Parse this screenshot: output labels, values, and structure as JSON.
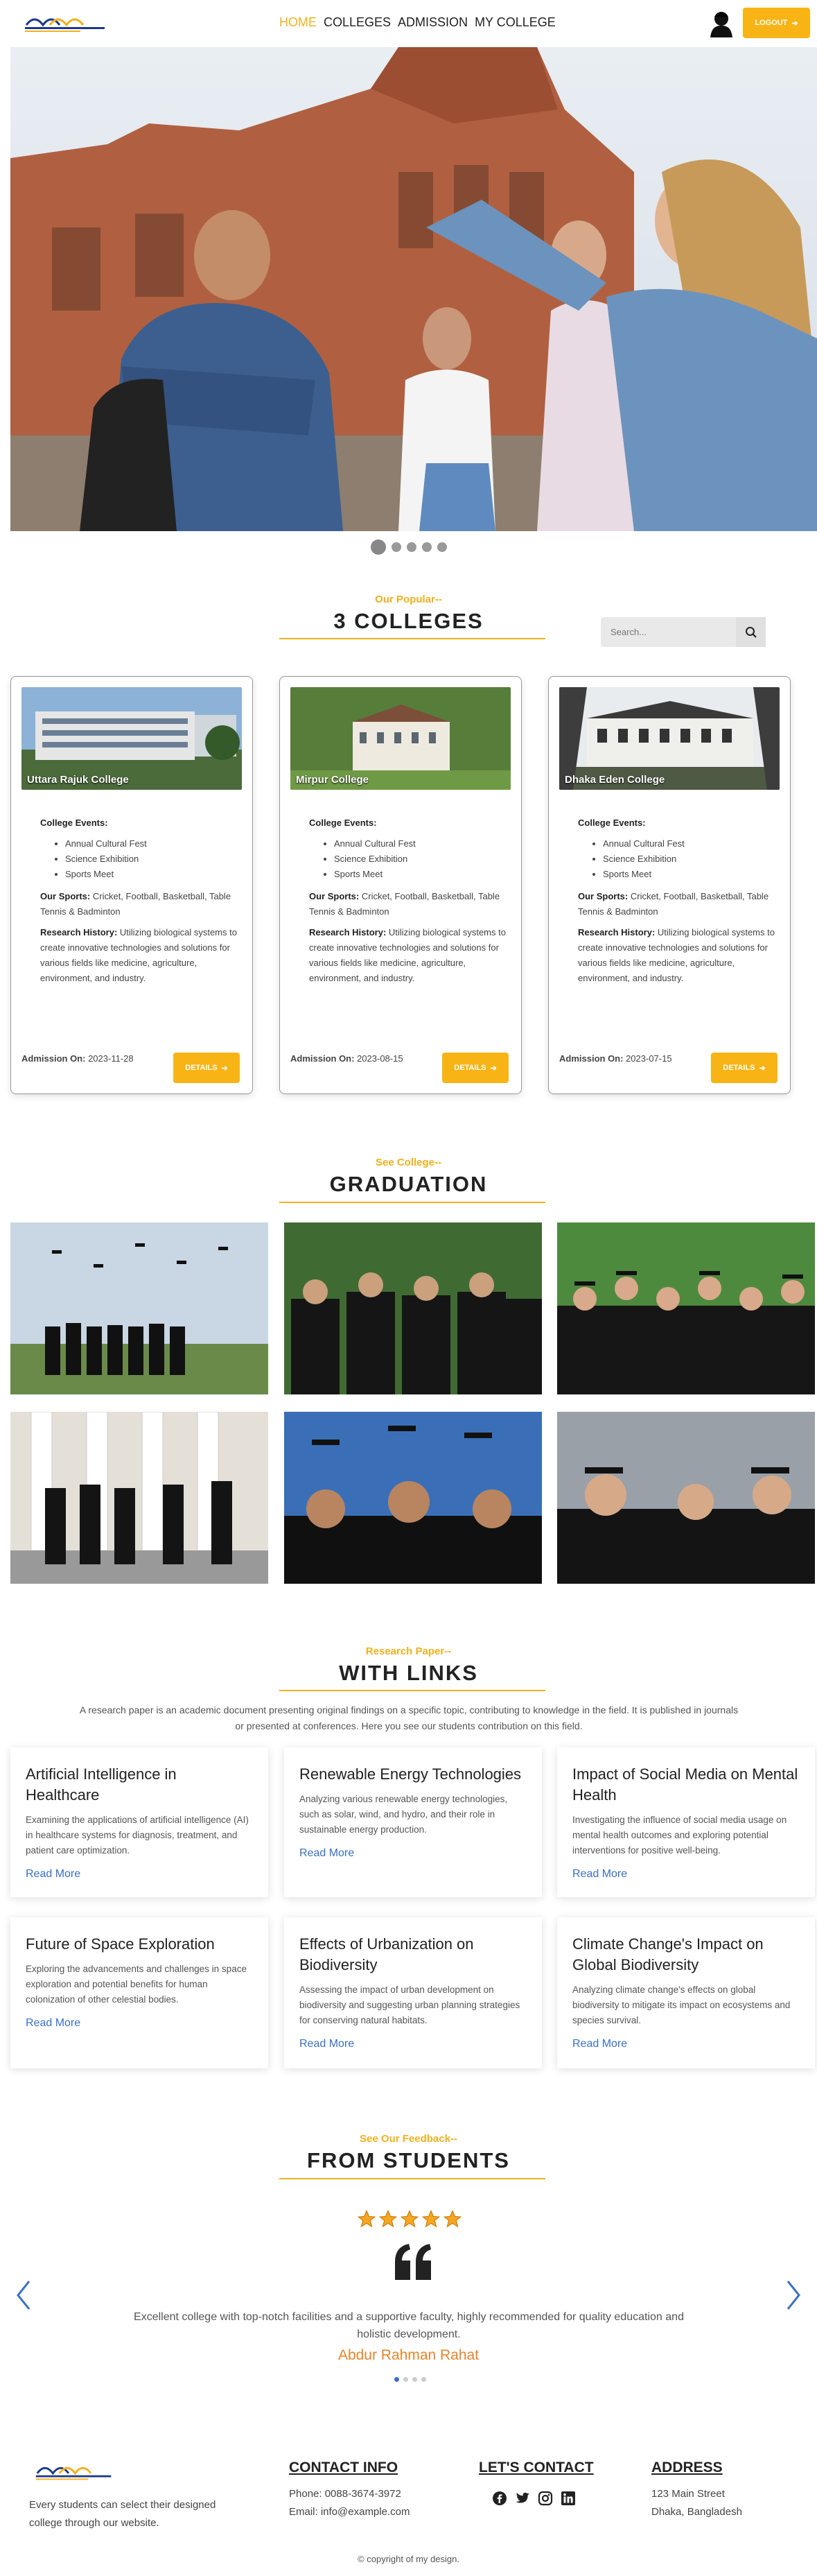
{
  "nav": {
    "links": [
      "HOME",
      "COLLEGES",
      "ADMISSION",
      "MY COLLEGE"
    ],
    "logout_label": "LOGOUT"
  },
  "colleges_section": {
    "subtitle": "Our Popular--",
    "title": "3 COLLEGES",
    "search_placeholder": "Search..."
  },
  "colleges": [
    {
      "name": "Uttara Rajuk College",
      "events_label": "College Events:",
      "events": [
        "Annual Cultural Fest",
        "Science Exhibition",
        "Sports Meet"
      ],
      "sports_label": "Our Sports:",
      "sports": "Cricket, Football, Basketball, Table Tennis & Badminton",
      "research_label": "Research History:",
      "research": "Utilizing biological systems to create innovative technologies and solutions for various fields like medicine, agriculture, environment, and industry.",
      "admission_label": "Admission On:",
      "admission": "2023-11-28",
      "details_label": "DETAILS"
    },
    {
      "name": "Mirpur College",
      "events_label": "College Events:",
      "events": [
        "Annual Cultural Fest",
        "Science Exhibition",
        "Sports Meet"
      ],
      "sports_label": "Our Sports:",
      "sports": "Cricket, Football, Basketball, Table Tennis & Badminton",
      "research_label": "Research History:",
      "research": "Utilizing biological systems to create innovative technologies and solutions for various fields like medicine, agriculture, environment, and industry.",
      "admission_label": "Admission On:",
      "admission": "2023-08-15",
      "details_label": "DETAILS"
    },
    {
      "name": "Dhaka Eden College",
      "events_label": "College Events:",
      "events": [
        "Annual Cultural Fest",
        "Science Exhibition",
        "Sports Meet"
      ],
      "sports_label": "Our Sports:",
      "sports": "Cricket, Football, Basketball, Table Tennis & Badminton",
      "research_label": "Research History:",
      "research": "Utilizing biological systems to create innovative technologies and solutions for various fields like medicine, agriculture, environment, and industry.",
      "admission_label": "Admission On:",
      "admission": "2023-07-15",
      "details_label": "DETAILS"
    }
  ],
  "graduation_section": {
    "subtitle": "See College--",
    "title": "GRADUATION"
  },
  "papers_section": {
    "subtitle": "Research Paper--",
    "title": "WITH LINKS",
    "intro": "A research paper is an academic document presenting original findings on a specific topic, contributing to knowledge in the field. It is published in journals or presented at conferences. Here you see our students contribution on this field."
  },
  "papers": [
    {
      "title": "Artificial Intelligence in Healthcare",
      "desc": "Examining the applications of artificial intelligence (AI) in healthcare systems for diagnosis, treatment, and patient care optimization.",
      "link": "Read More"
    },
    {
      "title": "Renewable Energy Technologies",
      "desc": "Analyzing various renewable energy technologies, such as solar, wind, and hydro, and their role in sustainable energy production.",
      "link": "Read More"
    },
    {
      "title": "Impact of Social Media on Mental Health",
      "desc": "Investigating the influence of social media usage on mental health outcomes and exploring potential interventions for positive well-being.",
      "link": "Read More"
    },
    {
      "title": "Future of Space Exploration",
      "desc": "Exploring the advancements and challenges in space exploration and potential benefits for human colonization of other celestial bodies.",
      "link": "Read More"
    },
    {
      "title": "Effects of Urbanization on Biodiversity",
      "desc": "Assessing the impact of urban development on biodiversity and suggesting urban planning strategies for conserving natural habitats.",
      "link": "Read More"
    },
    {
      "title": "Climate Change's Impact on Global Biodiversity",
      "desc": "Analyzing climate change's effects on global biodiversity to mitigate its impact on ecosystems and species survival.",
      "link": "Read More"
    }
  ],
  "feedback_section": {
    "subtitle": "See Our Feedback--",
    "title": "FROM STUDENTS",
    "rating": 5,
    "quote": "Excellent college with top-notch facilities and a supportive faculty, highly recommended for quality education and holistic development.",
    "author": "Abdur Rahman Rahat"
  },
  "footer": {
    "about": "Every students can select their designed college through our website.",
    "contact_heading": "CONTACT INFO",
    "phone": "Phone: 0088-3674-3972",
    "email": "Email: info@example.com",
    "social_heading": "LET'S CONTACT",
    "social_icons": [
      "facebook-icon",
      "twitter-icon",
      "instagram-icon",
      "linkedin-icon"
    ],
    "address_heading": "ADDRESS",
    "address_line1": "123 Main Street",
    "address_line2": "Dhaka, Bangladesh",
    "copyright": "© copyright of my design."
  },
  "colors": {
    "accent": "#f8b415",
    "link": "#3a6fc4",
    "author": "#e8842c",
    "dark": "#222222"
  }
}
